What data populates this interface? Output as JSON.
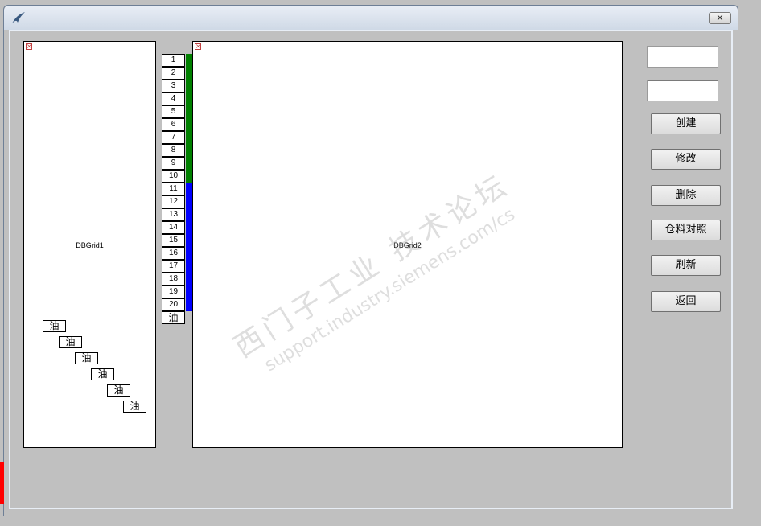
{
  "window": {
    "close_icon": "close-x-icon",
    "app_icon": "feather-icon"
  },
  "grid1": {
    "label": "DBGrid1"
  },
  "grid2": {
    "label": "DBGrid2"
  },
  "oil_cells": [
    "油",
    "油",
    "油",
    "油",
    "油",
    "油"
  ],
  "row_numbers": [
    "1",
    "2",
    "3",
    "4",
    "5",
    "6",
    "7",
    "8",
    "9",
    "10",
    "11",
    "12",
    "13",
    "14",
    "15",
    "16",
    "17",
    "18",
    "19",
    "20",
    "油"
  ],
  "colors": {
    "green_bar": "#008000",
    "blue_bar": "#0000ff",
    "red_strip": "#ff0000"
  },
  "inputs": {
    "field1_value": "",
    "field2_value": ""
  },
  "buttons": {
    "create": "创建",
    "modify": "修改",
    "delete": "删除",
    "warehouse_compare": "仓料对照",
    "refresh": "刷新",
    "back": "返回"
  },
  "watermark": {
    "line1": "西门子工业  技术论坛",
    "line2": "support.industry.siemens.com/cs"
  }
}
